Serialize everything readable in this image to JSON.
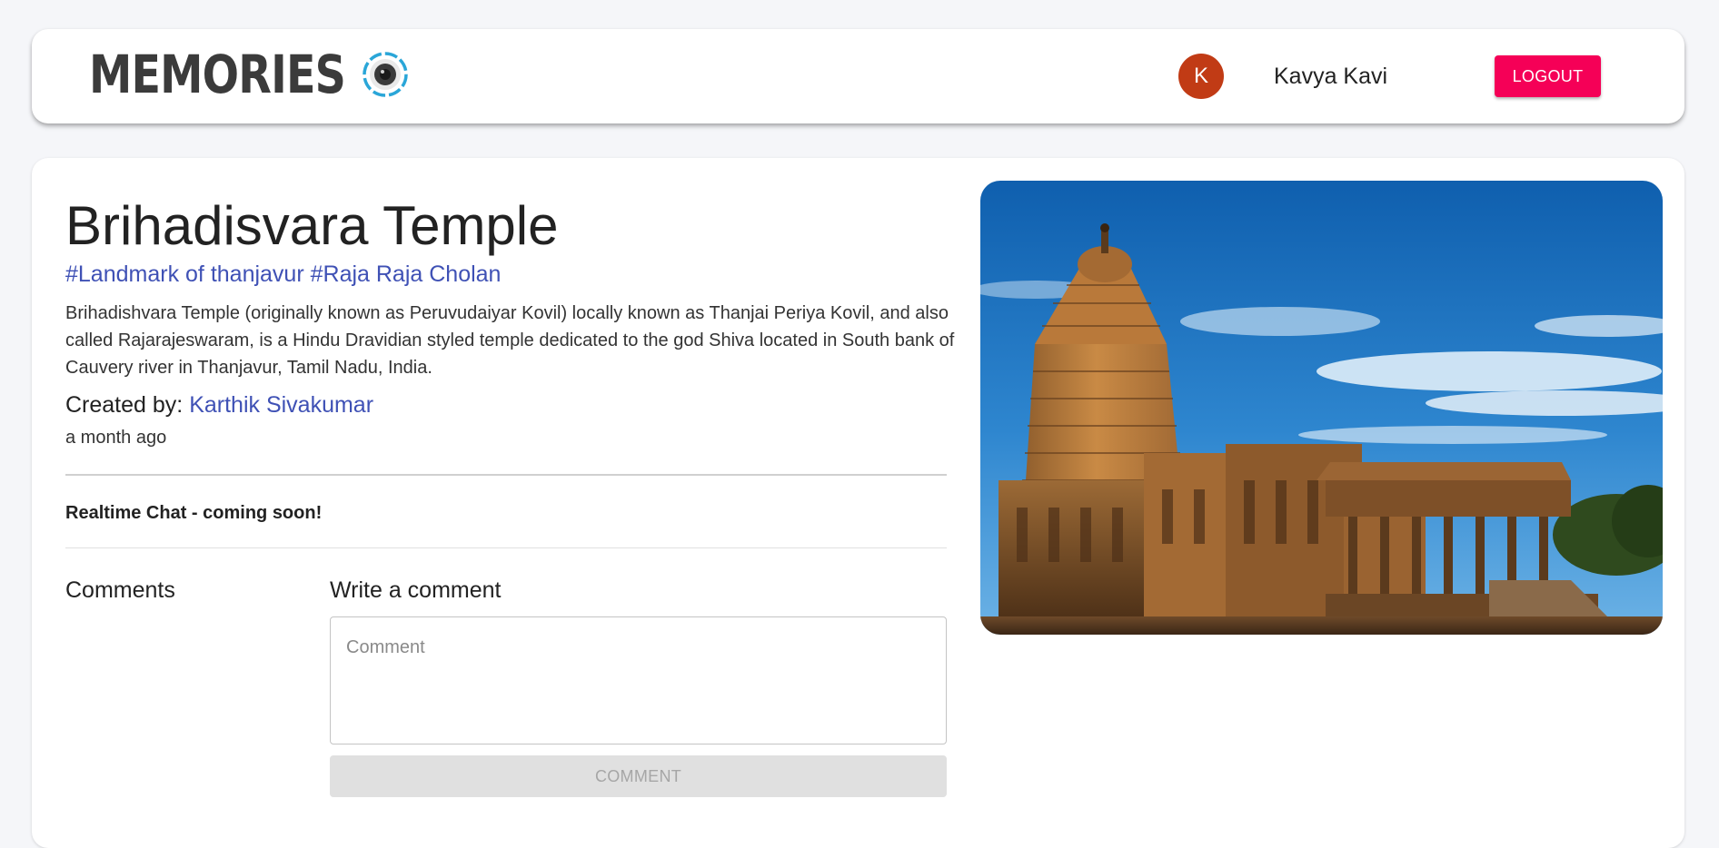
{
  "header": {
    "brand_text": "MEMORIES",
    "avatar_initial": "K",
    "user_name": "Kavya Kavi",
    "logout_label": "LOGOUT"
  },
  "post": {
    "title": "Brihadisvara Temple",
    "tags": "#Landmark of thanjavur #Raja Raja Cholan",
    "description": "Brihadishvara Temple (originally known as Peruvudaiyar Kovil) locally known as Thanjai Periya Kovil, and also called Rajarajeswaram, is a Hindu Dravidian styled temple dedicated to the god Shiva located in South bank of Cauvery river in Thanjavur, Tamil Nadu, India.",
    "created_by_label": "Created by: ",
    "creator_name": "Karthik Sivakumar",
    "time_ago": "a month ago",
    "realtime_notice": "Realtime Chat - coming soon!"
  },
  "comments": {
    "heading": "Comments",
    "write_heading": "Write a comment",
    "input_placeholder": "Comment",
    "input_value": "",
    "submit_label": "COMMENT"
  },
  "colors": {
    "accent": "#3f51b5",
    "logout": "#f50057",
    "avatar": "#c13b15",
    "page_bg": "#f5f6f9"
  }
}
